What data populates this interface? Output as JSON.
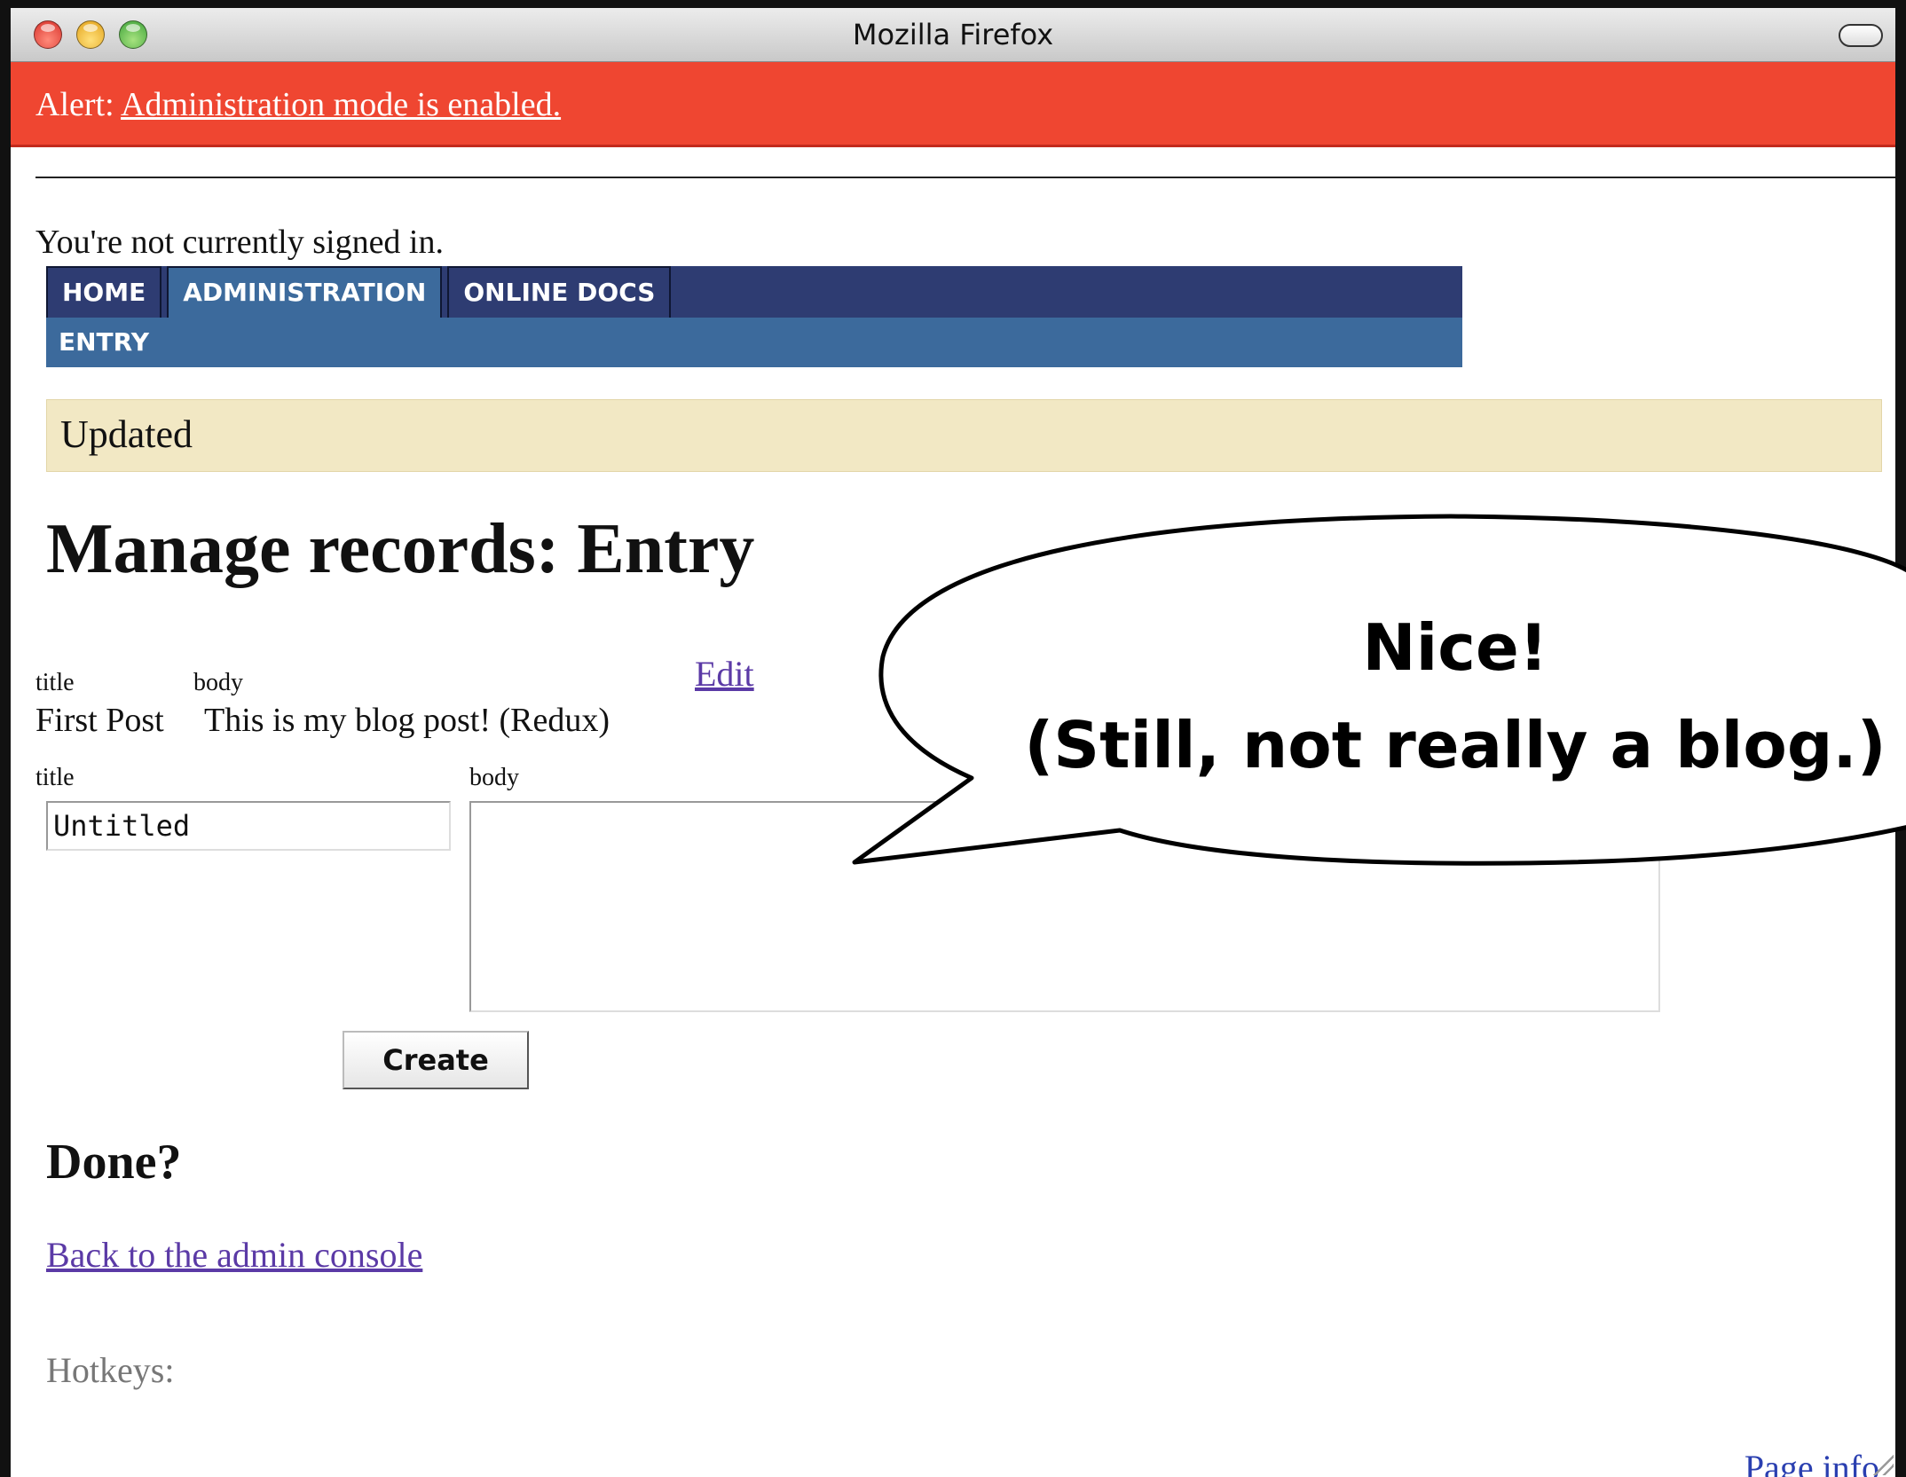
{
  "window": {
    "title": "Mozilla Firefox"
  },
  "alert": {
    "prefix": "Alert:",
    "link": "Administration mode is enabled."
  },
  "signin_status": "You're not currently signed in.",
  "nav": {
    "tabs": [
      {
        "label": "HOME",
        "active": false
      },
      {
        "label": "ADMINISTRATION",
        "active": true
      },
      {
        "label": "ONLINE DOCS",
        "active": false
      }
    ],
    "sub": {
      "label": "ENTRY"
    }
  },
  "flash": "Updated",
  "page_title": "Manage records: Entry",
  "table": {
    "headers": {
      "title": "title",
      "body": "body"
    },
    "edit_label": "Edit",
    "rows": [
      {
        "title": "First Post",
        "body": "This is my blog post! (Redux)"
      }
    ]
  },
  "form": {
    "title_label": "title",
    "body_label": "body",
    "title_value": "Untitled",
    "create_label": "Create"
  },
  "done": {
    "heading": "Done?",
    "back_link": "Back to the admin console"
  },
  "hotkeys": "Hotkeys:",
  "page_info": "Page info",
  "callout": {
    "line1": "Nice!",
    "line2": "(Still, not really a blog.)"
  },
  "colors": {
    "alert_bg": "#ef4631",
    "nav_main": "#2e3c72",
    "nav_sub": "#3c6a9c",
    "flash_bg": "#f2e8c4",
    "link": "#5b3aa6"
  }
}
